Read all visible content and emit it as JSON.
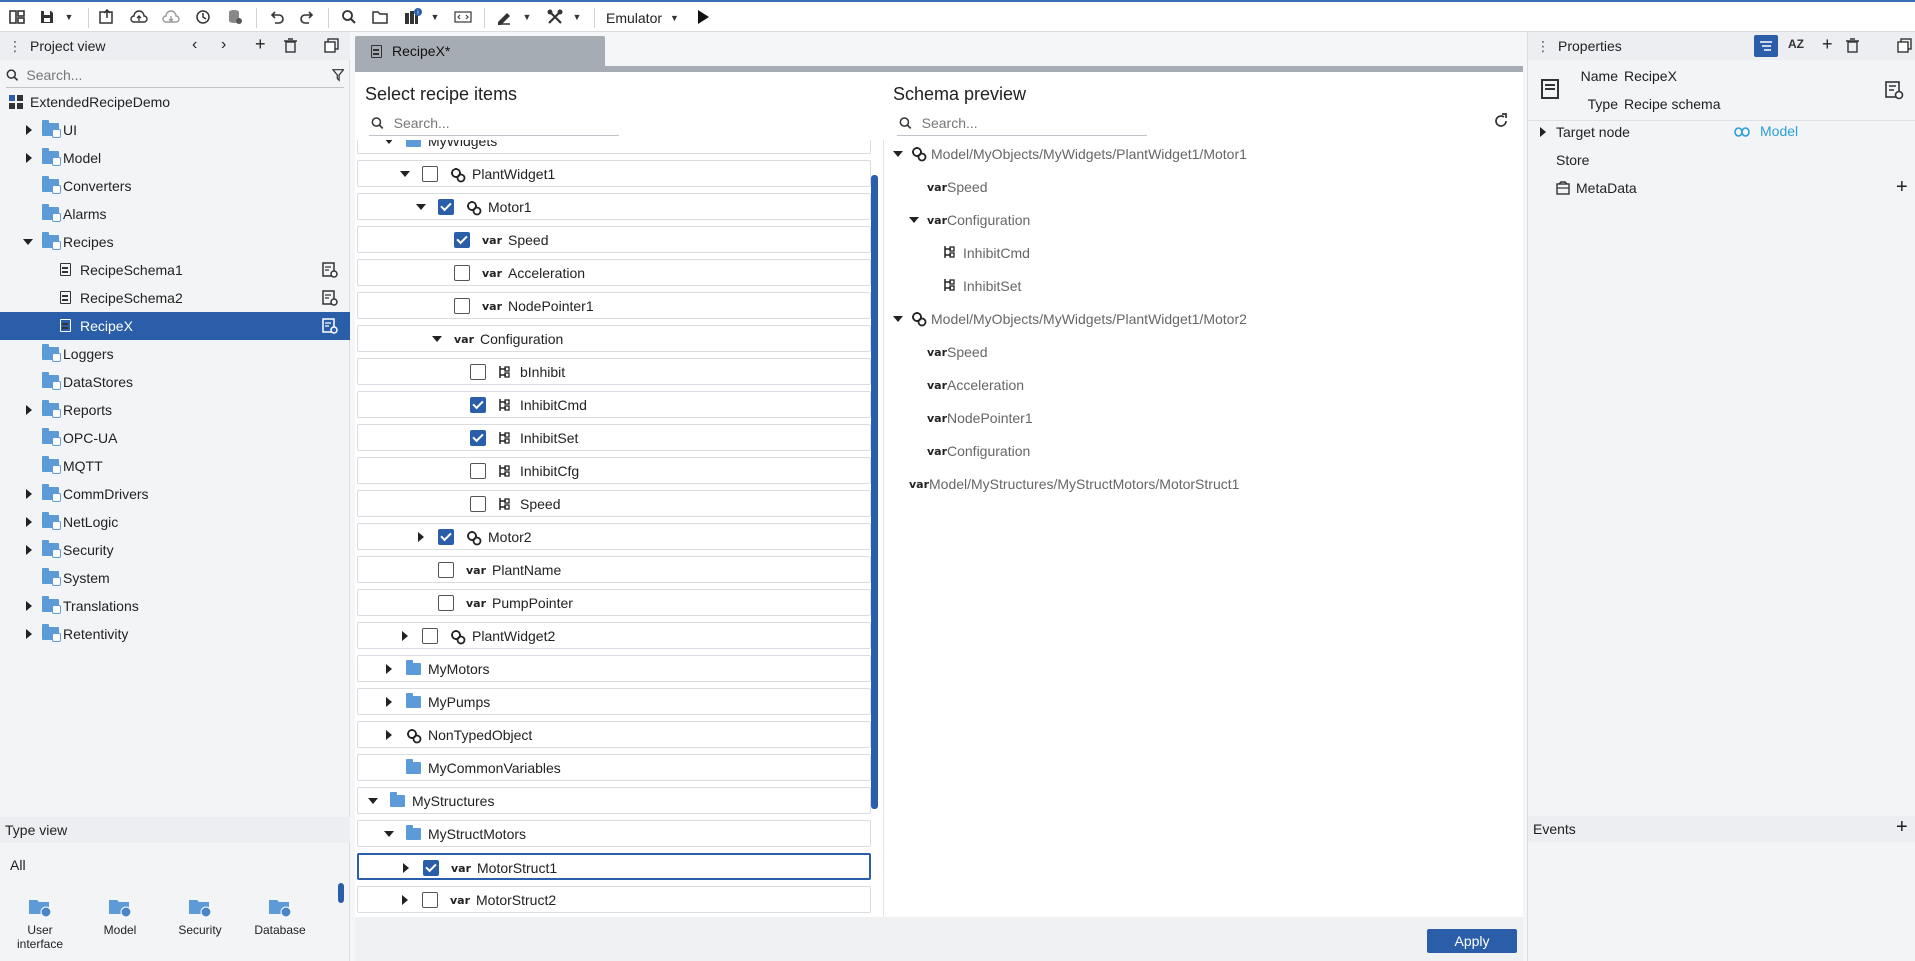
{
  "toolbar": {
    "emulator_label": "Emulator"
  },
  "project_view": {
    "title": "Project view",
    "search_placeholder": "Search...",
    "root": "ExtendedRecipeDemo",
    "items": [
      {
        "label": "UI",
        "expandable": true
      },
      {
        "label": "Model",
        "expandable": true
      },
      {
        "label": "Converters",
        "expandable": false
      },
      {
        "label": "Alarms",
        "expandable": false
      },
      {
        "label": "Recipes",
        "expandable": true,
        "expanded": true
      },
      {
        "label": "RecipeSchema1",
        "child": true
      },
      {
        "label": "RecipeSchema2",
        "child": true
      },
      {
        "label": "RecipeX",
        "child": true,
        "selected": true
      },
      {
        "label": "Loggers",
        "expandable": false
      },
      {
        "label": "DataStores",
        "expandable": false
      },
      {
        "label": "Reports",
        "expandable": true
      },
      {
        "label": "OPC-UA",
        "expandable": false
      },
      {
        "label": "MQTT",
        "expandable": false
      },
      {
        "label": "CommDrivers",
        "expandable": true
      },
      {
        "label": "NetLogic",
        "expandable": true
      },
      {
        "label": "Security",
        "expandable": true
      },
      {
        "label": "System",
        "expandable": false
      },
      {
        "label": "Translations",
        "expandable": true
      },
      {
        "label": "Retentivity",
        "expandable": true
      }
    ]
  },
  "type_view": {
    "title": "Type view",
    "filter": "All",
    "items": [
      "User\ninterface",
      "Model",
      "Security",
      "Database"
    ]
  },
  "editor": {
    "tab_label": "RecipeX*",
    "left_title": "Select recipe items",
    "right_title": "Schema preview",
    "search_placeholder": "Search...",
    "recipe_items": [
      {
        "label": "MyWidgets",
        "kind": "folder",
        "indent": 1,
        "arrow": "down",
        "checkbox": false,
        "partial": true
      },
      {
        "label": "PlantWidget1",
        "kind": "object",
        "indent": 2,
        "arrow": "down",
        "checkbox": true,
        "checked": false
      },
      {
        "label": "Motor1",
        "kind": "object",
        "indent": 3,
        "arrow": "down",
        "checkbox": true,
        "checked": true
      },
      {
        "label": "Speed",
        "kind": "var",
        "indent": 4,
        "arrow": "none",
        "checkbox": true,
        "checked": true
      },
      {
        "label": "Acceleration",
        "kind": "var",
        "indent": 4,
        "arrow": "none",
        "checkbox": true,
        "checked": false
      },
      {
        "label": "NodePointer1",
        "kind": "var",
        "indent": 4,
        "arrow": "none",
        "checkbox": true,
        "checked": false
      },
      {
        "label": "Configuration",
        "kind": "var",
        "indent": 4,
        "arrow": "down",
        "checkbox": false
      },
      {
        "label": "bInhibit",
        "kind": "prop",
        "indent": 5,
        "arrow": "none",
        "checkbox": true,
        "checked": false
      },
      {
        "label": "InhibitCmd",
        "kind": "prop",
        "indent": 5,
        "arrow": "none",
        "checkbox": true,
        "checked": true
      },
      {
        "label": "InhibitSet",
        "kind": "prop",
        "indent": 5,
        "arrow": "none",
        "checkbox": true,
        "checked": true
      },
      {
        "label": "InhibitCfg",
        "kind": "prop",
        "indent": 5,
        "arrow": "none",
        "checkbox": true,
        "checked": false
      },
      {
        "label": "Speed",
        "kind": "prop",
        "indent": 5,
        "arrow": "none",
        "checkbox": true,
        "checked": false
      },
      {
        "label": "Motor2",
        "kind": "object",
        "indent": 3,
        "arrow": "right",
        "checkbox": true,
        "checked": true
      },
      {
        "label": "PlantName",
        "kind": "var",
        "indent": 3,
        "arrow": "none",
        "checkbox": true,
        "checked": false
      },
      {
        "label": "PumpPointer",
        "kind": "var",
        "indent": 3,
        "arrow": "none",
        "checkbox": true,
        "checked": false
      },
      {
        "label": "PlantWidget2",
        "kind": "object",
        "indent": 2,
        "arrow": "right",
        "checkbox": true,
        "checked": false
      },
      {
        "label": "MyMotors",
        "kind": "folder",
        "indent": 1,
        "arrow": "right",
        "checkbox": false
      },
      {
        "label": "MyPumps",
        "kind": "folder",
        "indent": 1,
        "arrow": "right",
        "checkbox": false
      },
      {
        "label": "NonTypedObject",
        "kind": "object",
        "indent": 1,
        "arrow": "right",
        "checkbox": false
      },
      {
        "label": "MyCommonVariables",
        "kind": "folder",
        "indent": 1,
        "arrow": "none",
        "checkbox": false
      },
      {
        "label": "MyStructures",
        "kind": "folder",
        "indent": 0,
        "arrow": "down",
        "checkbox": false
      },
      {
        "label": "MyStructMotors",
        "kind": "folder",
        "indent": 1,
        "arrow": "down",
        "checkbox": false
      },
      {
        "label": "MotorStruct1",
        "kind": "var",
        "indent": 2,
        "arrow": "right",
        "checkbox": true,
        "checked": true,
        "focused": true
      },
      {
        "label": "MotorStruct2",
        "kind": "var",
        "indent": 2,
        "arrow": "right",
        "checkbox": true,
        "checked": false
      }
    ],
    "schema_preview": [
      {
        "label": "Model/MyObjects/MyWidgets/PlantWidget1/Motor1",
        "kind": "object",
        "indent": 0,
        "arrow": "down"
      },
      {
        "label": "Speed",
        "kind": "var",
        "indent": 1,
        "arrow": "none"
      },
      {
        "label": "Configuration",
        "kind": "var",
        "indent": 1,
        "arrow": "down"
      },
      {
        "label": "InhibitCmd",
        "kind": "prop",
        "indent": 2,
        "arrow": "none"
      },
      {
        "label": "InhibitSet",
        "kind": "prop",
        "indent": 2,
        "arrow": "none"
      },
      {
        "label": "Model/MyObjects/MyWidgets/PlantWidget1/Motor2",
        "kind": "object",
        "indent": 0,
        "arrow": "down"
      },
      {
        "label": "Speed",
        "kind": "var",
        "indent": 1,
        "arrow": "none"
      },
      {
        "label": "Acceleration",
        "kind": "var",
        "indent": 1,
        "arrow": "none"
      },
      {
        "label": "NodePointer1",
        "kind": "var",
        "indent": 1,
        "arrow": "none"
      },
      {
        "label": "Configuration",
        "kind": "var",
        "indent": 1,
        "arrow": "none"
      },
      {
        "label": "Model/MyStructures/MyStructMotors/MotorStruct1",
        "kind": "var",
        "indent": 0,
        "arrow": "none"
      }
    ],
    "apply_label": "Apply"
  },
  "properties": {
    "title": "Properties",
    "name_label": "Name",
    "name_value": "RecipeX",
    "type_label": "Type",
    "type_value": "Recipe schema",
    "target_node_label": "Target node",
    "target_node_value": "Model",
    "store_label": "Store",
    "metadata_label": "MetaData",
    "events_title": "Events"
  },
  "colors": {
    "accent": "#2b5ea8",
    "folder": "#5d9bd8",
    "link": "#2a9fd6"
  }
}
